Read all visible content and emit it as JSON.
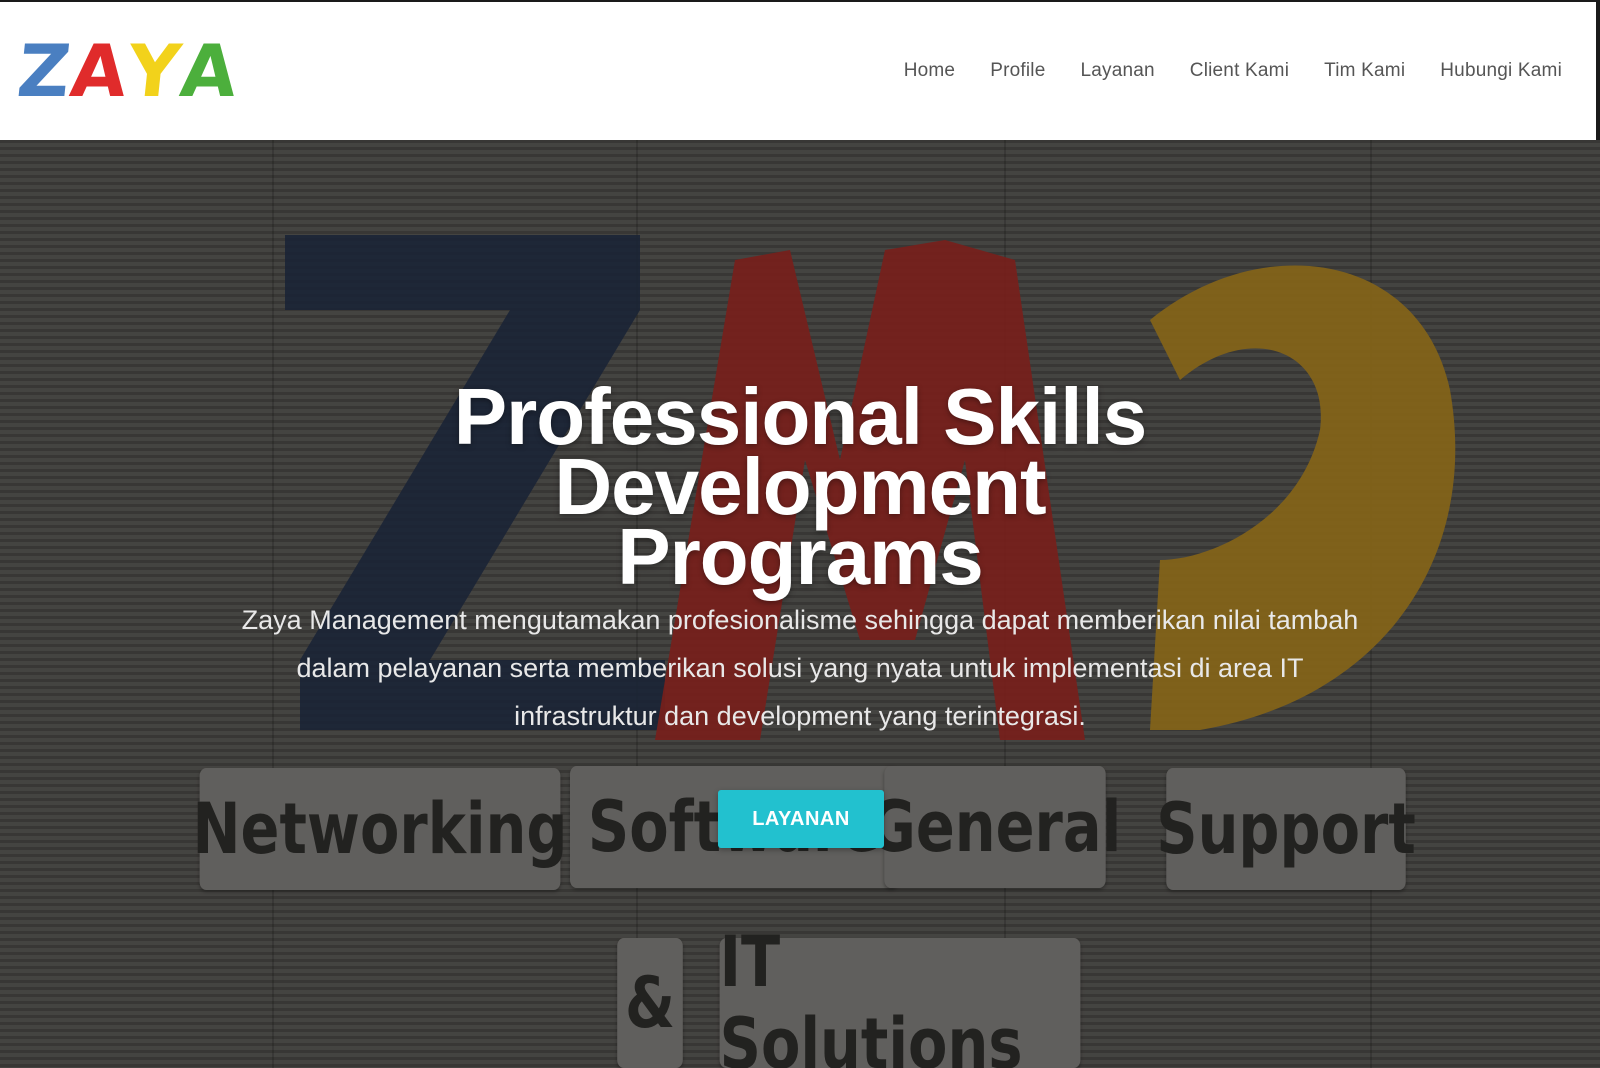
{
  "brand": {
    "logo_letters": [
      "Z",
      "A",
      "Y",
      "A"
    ],
    "logo_colors": [
      "#4a7fc1",
      "#e02b2b",
      "#f2d21b",
      "#4caf3c"
    ]
  },
  "nav": {
    "items": [
      "Home",
      "Profile",
      "Layanan",
      "Client Kami",
      "Tim Kami",
      "Hubungi Kami"
    ]
  },
  "hero": {
    "title_line1": "Professional Skills Development",
    "title_line2": "Programs",
    "description_lines": [
      "Zaya Management mengutamakan profesionalisme sehingga dapat memberikan nilai tambah",
      "dalam pelayanan serta memberikan solusi yang nyata untuk implementasi di area IT",
      "infrastruktur dan development yang terintegrasi."
    ],
    "cta_label": "LAYANAN",
    "cta_color": "#22c1cf",
    "background_image": {
      "big_letters": [
        "Z",
        "M",
        "D"
      ],
      "big_letter_colors": [
        "#1e2d4a",
        "#b3261f",
        "#c9951a"
      ],
      "tiles": [
        "Networking",
        "Software",
        "General",
        "Support",
        "&",
        "IT Solutions"
      ]
    }
  }
}
